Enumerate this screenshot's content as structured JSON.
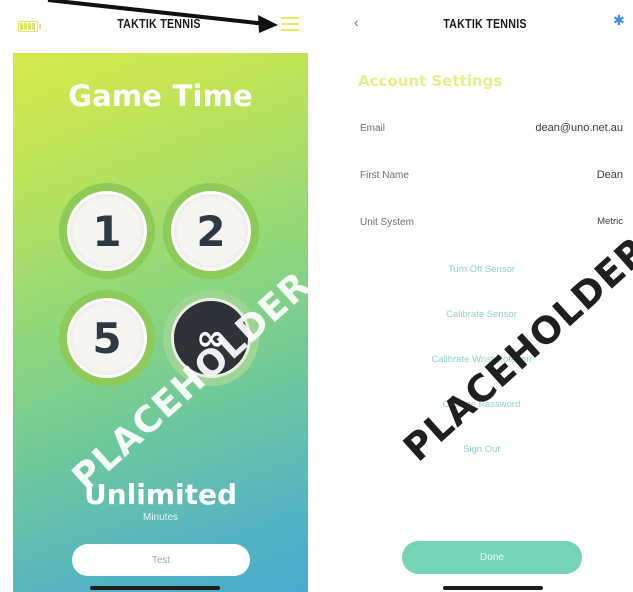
{
  "brand": "TAKTIK TENNIS",
  "left_screen": {
    "title": "Game Time",
    "time_options": [
      {
        "label": "1"
      },
      {
        "label": "2"
      },
      {
        "label": "5"
      },
      {
        "label": "∞"
      }
    ],
    "selected_label": "Unlimited",
    "selected_unit": "Minutes",
    "test_button": "Test"
  },
  "right_screen": {
    "back_icon": "chevron-left-icon",
    "bluetooth_icon": "bluetooth-icon",
    "section_title": "Account Settings",
    "rows": [
      {
        "label": "Email",
        "value": "dean@uno.net.au"
      },
      {
        "label": "First Name",
        "value": "Dean"
      },
      {
        "label": "Unit System",
        "value": "Metric"
      }
    ],
    "actions": [
      "Turn Off Sensor",
      "Calibrate Sensor",
      "Calibrate Wrist Rotation",
      "Change Password",
      "Sign Out"
    ],
    "done_button": "Done"
  },
  "watermark": "PLACEHOLDER",
  "colors": {
    "accent_yellow": "#e3ea58",
    "teal": "#74d4b6",
    "link_teal": "#8fd3cc"
  }
}
